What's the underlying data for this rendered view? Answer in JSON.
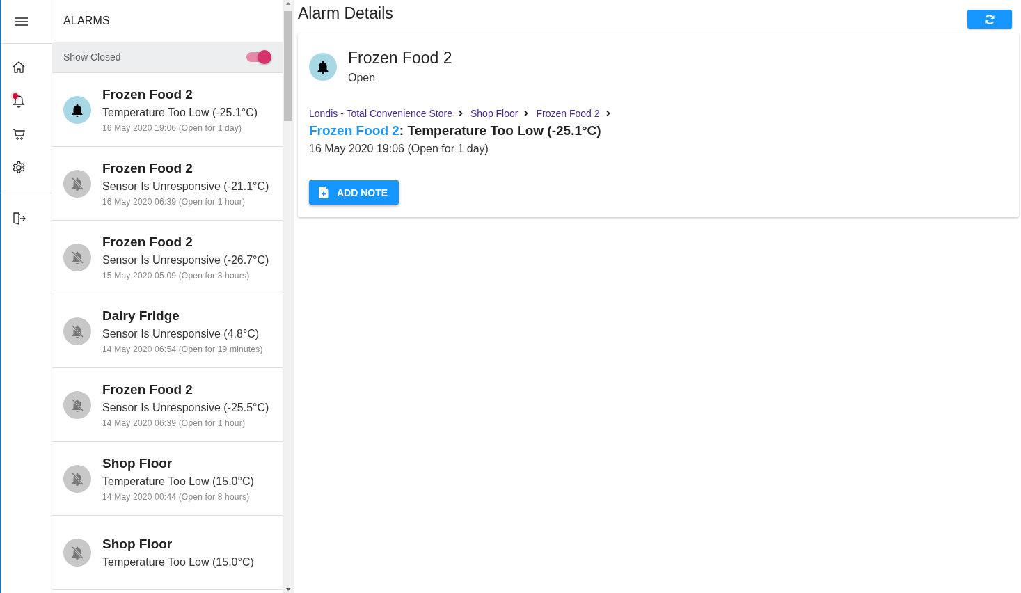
{
  "nav": {
    "items": [
      {
        "kind": "home",
        "alert": false
      },
      {
        "kind": "alarms",
        "alert": true
      },
      {
        "kind": "cart",
        "alert": false
      },
      {
        "kind": "settings",
        "alert": false
      },
      {
        "kind": "logout",
        "alert": false
      }
    ]
  },
  "alarm_list": {
    "title": "ALARMS",
    "show_closed": {
      "label": "Show Closed",
      "on": true
    },
    "items": [
      {
        "name": "Frozen Food 2",
        "description": "Temperature Too Low (-25.1°C)",
        "time": "16 May 2020 19:06 (Open for 1 day)",
        "open": true
      },
      {
        "name": "Frozen Food 2",
        "description": "Sensor Is Unresponsive (-21.1°C)",
        "time": "16 May 2020 06:39 (Open for 1 hour)",
        "open": false
      },
      {
        "name": "Frozen Food 2",
        "description": "Sensor Is Unresponsive (-26.7°C)",
        "time": "15 May 2020 05:09 (Open for 3 hours)",
        "open": false
      },
      {
        "name": "Dairy Fridge",
        "description": "Sensor Is Unresponsive (4.8°C)",
        "time": "14 May 2020 06:54 (Open for 19 minutes)",
        "open": false
      },
      {
        "name": "Frozen Food 2",
        "description": "Sensor Is Unresponsive (-25.5°C)",
        "time": "14 May 2020 06:39 (Open for 1 hour)",
        "open": false
      },
      {
        "name": "Shop Floor",
        "description": "Temperature Too Low (15.0°C)",
        "time": "14 May 2020 00:44 (Open for 8 hours)",
        "open": false
      },
      {
        "name": "Shop Floor",
        "description": "Temperature Too Low (15.0°C)",
        "open": false
      }
    ]
  },
  "details": {
    "title": "Alarm Details",
    "name": "Frozen Food 2",
    "status": "Open",
    "open": true,
    "breadcrumb": [
      "Londis - Total Convenience Store",
      "Shop Floor",
      "Frozen Food 2"
    ],
    "heading_link": "Frozen Food 2",
    "heading_text": ": Temperature Too Low (-25.1°C)",
    "time": "16 May 2020 19:06 (Open for 1 day)",
    "add_note": "ADD NOTE"
  }
}
